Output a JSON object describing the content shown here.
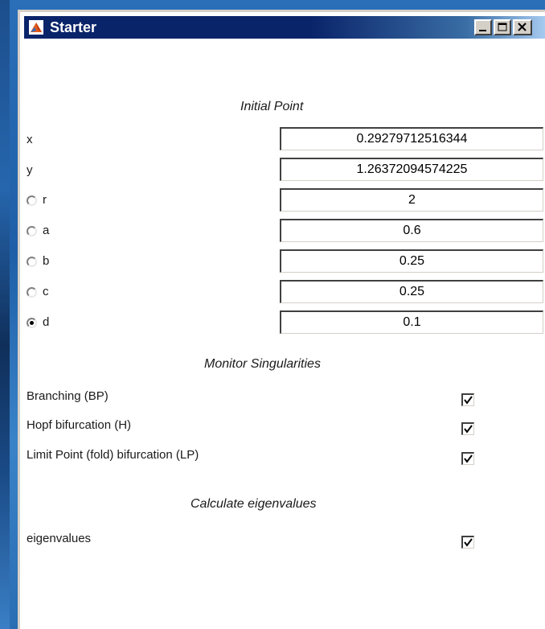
{
  "window": {
    "title": "Starter",
    "icon": "matlab-icon",
    "controls": [
      "minimize-icon",
      "maximize-icon",
      "close-icon"
    ]
  },
  "initial_point": {
    "heading": "Initial Point",
    "x": {
      "label": "x",
      "value": "0.29279712516344"
    },
    "y": {
      "label": "y",
      "value": "1.26372094574225"
    },
    "params": [
      {
        "label": "r",
        "value": "2",
        "selected": false
      },
      {
        "label": "a",
        "value": "0.6",
        "selected": false
      },
      {
        "label": "b",
        "value": "0.25",
        "selected": false
      },
      {
        "label": "c",
        "value": "0.25",
        "selected": false
      },
      {
        "label": "d",
        "value": "0.1",
        "selected": true
      }
    ]
  },
  "monitor": {
    "heading": "Monitor Singularities",
    "items": [
      {
        "label": "Branching (BP)",
        "checked": true
      },
      {
        "label": "Hopf bifurcation (H)",
        "checked": true
      },
      {
        "label": "Limit Point (fold) bifurcation (LP)",
        "checked": true
      }
    ]
  },
  "eigen": {
    "heading": "Calculate eigenvalues",
    "items": [
      {
        "label": "eigenvalues",
        "checked": true
      }
    ]
  },
  "colors": {
    "titlebar_start": "#0a246a",
    "titlebar_end": "#a6caf0",
    "window_frame": "#d4d0c8"
  }
}
